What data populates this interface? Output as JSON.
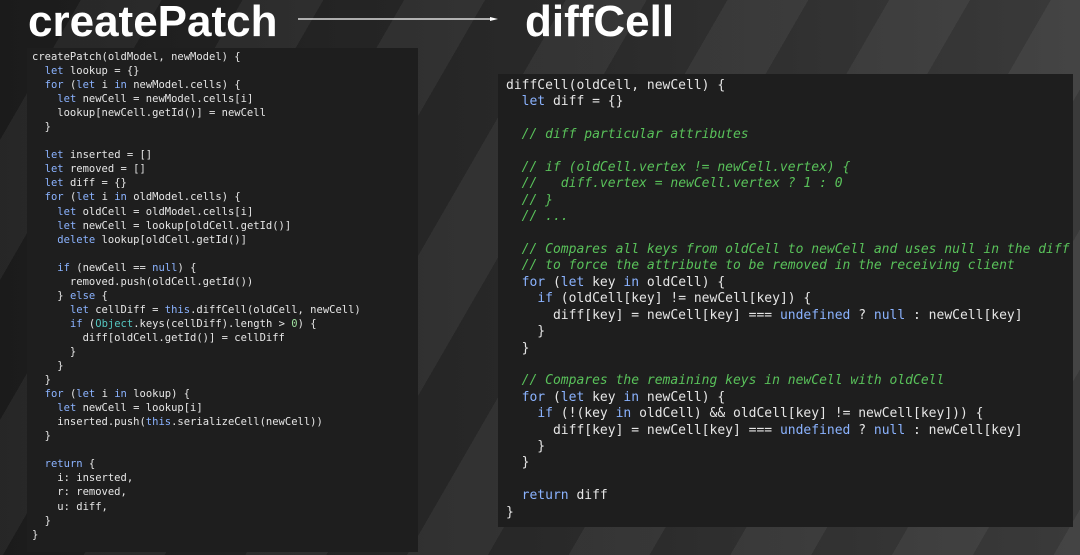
{
  "titles": {
    "left": "createPatch",
    "right": "diffCell"
  },
  "colors": {
    "keyword": "#8bb3ff",
    "builtin": "#55c6c0",
    "number": "#9fe09f",
    "comment": "#59c15a",
    "text": "#e6e6e6",
    "panel_background": "#1e1e1e"
  },
  "code_left": [
    [
      [
        "createPatch(oldModel, newModel) {",
        ""
      ]
    ],
    [
      [
        "  ",
        ""
      ],
      [
        "let",
        "kw"
      ],
      [
        " lookup = {}",
        ""
      ]
    ],
    [
      [
        "  ",
        ""
      ],
      [
        "for",
        "kw"
      ],
      [
        " (",
        ""
      ],
      [
        "let",
        "kw"
      ],
      [
        " i ",
        ""
      ],
      [
        "in",
        "kw"
      ],
      [
        " newModel.cells) {",
        ""
      ]
    ],
    [
      [
        "    ",
        ""
      ],
      [
        "let",
        "kw"
      ],
      [
        " newCell = newModel.cells[i]",
        ""
      ]
    ],
    [
      [
        "    lookup[newCell.getId()] = newCell",
        ""
      ]
    ],
    [
      [
        "  }",
        ""
      ]
    ],
    [],
    [
      [
        "  ",
        ""
      ],
      [
        "let",
        "kw"
      ],
      [
        " inserted = []",
        ""
      ]
    ],
    [
      [
        "  ",
        ""
      ],
      [
        "let",
        "kw"
      ],
      [
        " removed = []",
        ""
      ]
    ],
    [
      [
        "  ",
        ""
      ],
      [
        "let",
        "kw"
      ],
      [
        " diff = {}",
        ""
      ]
    ],
    [
      [
        "  ",
        ""
      ],
      [
        "for",
        "kw"
      ],
      [
        " (",
        ""
      ],
      [
        "let",
        "kw"
      ],
      [
        " i ",
        ""
      ],
      [
        "in",
        "kw"
      ],
      [
        " oldModel.cells) {",
        ""
      ]
    ],
    [
      [
        "    ",
        ""
      ],
      [
        "let",
        "kw"
      ],
      [
        " oldCell = oldModel.cells[i]",
        ""
      ]
    ],
    [
      [
        "    ",
        ""
      ],
      [
        "let",
        "kw"
      ],
      [
        " newCell = lookup[oldCell.getId()]",
        ""
      ]
    ],
    [
      [
        "    ",
        ""
      ],
      [
        "delete",
        "kw"
      ],
      [
        " lookup[oldCell.getId()]",
        ""
      ]
    ],
    [],
    [
      [
        "    ",
        ""
      ],
      [
        "if",
        "kw"
      ],
      [
        " (newCell == ",
        ""
      ],
      [
        "null",
        "kw"
      ],
      [
        ") {",
        ""
      ]
    ],
    [
      [
        "      removed.push(oldCell.getId())",
        ""
      ]
    ],
    [
      [
        "    } ",
        ""
      ],
      [
        "else",
        "kw"
      ],
      [
        " {",
        ""
      ]
    ],
    [
      [
        "      ",
        ""
      ],
      [
        "let",
        "kw"
      ],
      [
        " cellDiff = ",
        ""
      ],
      [
        "this",
        "kw"
      ],
      [
        ".diffCell(oldCell, newCell)",
        ""
      ]
    ],
    [
      [
        "      ",
        ""
      ],
      [
        "if",
        "kw"
      ],
      [
        " (",
        ""
      ],
      [
        "Object",
        "bi"
      ],
      [
        ".keys(cellDiff).length > ",
        ""
      ],
      [
        "0",
        "nm"
      ],
      [
        ") {",
        ""
      ]
    ],
    [
      [
        "        diff[oldCell.getId()] = cellDiff",
        ""
      ]
    ],
    [
      [
        "      }",
        ""
      ]
    ],
    [
      [
        "    }",
        ""
      ]
    ],
    [
      [
        "  }",
        ""
      ]
    ],
    [
      [
        "  ",
        ""
      ],
      [
        "for",
        "kw"
      ],
      [
        " (",
        ""
      ],
      [
        "let",
        "kw"
      ],
      [
        " i ",
        ""
      ],
      [
        "in",
        "kw"
      ],
      [
        " lookup) {",
        ""
      ]
    ],
    [
      [
        "    ",
        ""
      ],
      [
        "let",
        "kw"
      ],
      [
        " newCell = lookup[i]",
        ""
      ]
    ],
    [
      [
        "    inserted.push(",
        ""
      ],
      [
        "this",
        "kw"
      ],
      [
        ".serializeCell(newCell))",
        ""
      ]
    ],
    [
      [
        "  }",
        ""
      ]
    ],
    [],
    [
      [
        "  ",
        ""
      ],
      [
        "return",
        "kw"
      ],
      [
        " {",
        ""
      ]
    ],
    [
      [
        "    i: inserted,",
        ""
      ]
    ],
    [
      [
        "    r: removed,",
        ""
      ]
    ],
    [
      [
        "    u: diff,",
        ""
      ]
    ],
    [
      [
        "  }",
        ""
      ]
    ],
    [
      [
        "}",
        ""
      ]
    ]
  ],
  "code_right": [
    [
      [
        "diffCell(oldCell, newCell) {",
        ""
      ]
    ],
    [
      [
        "  ",
        ""
      ],
      [
        "let",
        "kw"
      ],
      [
        " diff = {}",
        ""
      ]
    ],
    [],
    [
      [
        "  ",
        ""
      ],
      [
        "// diff particular attributes",
        "cm"
      ]
    ],
    [],
    [
      [
        "  ",
        ""
      ],
      [
        "// if (oldCell.vertex != newCell.vertex) {",
        "cm"
      ]
    ],
    [
      [
        "  ",
        ""
      ],
      [
        "//   diff.vertex = newCell.vertex ? 1 : 0",
        "cm"
      ]
    ],
    [
      [
        "  ",
        ""
      ],
      [
        "// }",
        "cm"
      ]
    ],
    [
      [
        "  ",
        ""
      ],
      [
        "// ...",
        "cm"
      ]
    ],
    [],
    [
      [
        "  ",
        ""
      ],
      [
        "// Compares all keys from oldCell to newCell and uses null in the diff",
        "cm"
      ]
    ],
    [
      [
        "  ",
        ""
      ],
      [
        "// to force the attribute to be removed in the receiving client",
        "cm"
      ]
    ],
    [
      [
        "  ",
        ""
      ],
      [
        "for",
        "kw"
      ],
      [
        " (",
        ""
      ],
      [
        "let",
        "kw"
      ],
      [
        " key ",
        ""
      ],
      [
        "in",
        "kw"
      ],
      [
        " oldCell) {",
        ""
      ]
    ],
    [
      [
        "    ",
        ""
      ],
      [
        "if",
        "kw"
      ],
      [
        " (oldCell[key] != newCell[key]) {",
        ""
      ]
    ],
    [
      [
        "      diff[key] = newCell[key] === ",
        ""
      ],
      [
        "undefined",
        "kw"
      ],
      [
        " ? ",
        ""
      ],
      [
        "null",
        "kw"
      ],
      [
        " : newCell[key]",
        ""
      ]
    ],
    [
      [
        "    }",
        ""
      ]
    ],
    [
      [
        "  }",
        ""
      ]
    ],
    [],
    [
      [
        "  ",
        ""
      ],
      [
        "// Compares the remaining keys in newCell with oldCell",
        "cm"
      ]
    ],
    [
      [
        "  ",
        ""
      ],
      [
        "for",
        "kw"
      ],
      [
        " (",
        ""
      ],
      [
        "let",
        "kw"
      ],
      [
        " key ",
        ""
      ],
      [
        "in",
        "kw"
      ],
      [
        " newCell) {",
        ""
      ]
    ],
    [
      [
        "    ",
        ""
      ],
      [
        "if",
        "kw"
      ],
      [
        " (!(key ",
        ""
      ],
      [
        "in",
        "kw"
      ],
      [
        " oldCell) && oldCell[key] != newCell[key])) {",
        ""
      ]
    ],
    [
      [
        "      diff[key] = newCell[key] === ",
        ""
      ],
      [
        "undefined",
        "kw"
      ],
      [
        " ? ",
        ""
      ],
      [
        "null",
        "kw"
      ],
      [
        " : newCell[key]",
        ""
      ]
    ],
    [
      [
        "    }",
        ""
      ]
    ],
    [
      [
        "  }",
        ""
      ]
    ],
    [],
    [
      [
        "  ",
        ""
      ],
      [
        "return",
        "kw"
      ],
      [
        " diff",
        ""
      ]
    ],
    [
      [
        "}",
        ""
      ]
    ]
  ]
}
